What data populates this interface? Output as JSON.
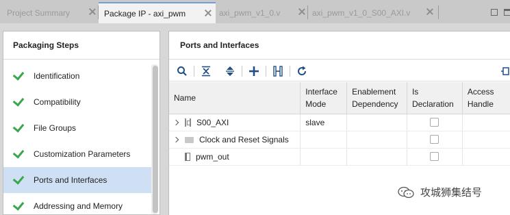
{
  "tabs": [
    {
      "label": "Project Summary",
      "active": false
    },
    {
      "label": "Package IP - axi_pwm",
      "active": true
    },
    {
      "label": "axi_pwm_v1_0.v",
      "active": false
    },
    {
      "label": "axi_pwm_v1_0_S00_AXI.v",
      "active": false
    }
  ],
  "left_panel": {
    "title": "Packaging Steps",
    "steps": [
      {
        "label": "Identification",
        "completed": true,
        "selected": false
      },
      {
        "label": "Compatibility",
        "completed": true,
        "selected": false
      },
      {
        "label": "File Groups",
        "completed": true,
        "selected": false
      },
      {
        "label": "Customization Parameters",
        "completed": true,
        "selected": false
      },
      {
        "label": "Ports and Interfaces",
        "completed": true,
        "selected": true
      },
      {
        "label": "Addressing and Memory",
        "completed": true,
        "selected": false
      }
    ]
  },
  "right_panel": {
    "title": "Ports and Interfaces",
    "toolbar_icons": [
      "search-icon",
      "collapse-all-icon",
      "expand-all-icon",
      "add-icon",
      "interface-icon",
      "refresh-icon"
    ],
    "columns": {
      "name": "Name",
      "interface_mode_1": "Interface",
      "interface_mode_2": "Mode",
      "enablement_1": "Enablement",
      "enablement_2": "Dependency",
      "is_declaration_1": "Is",
      "is_declaration_2": "Declaration",
      "access_handle_1": "Access",
      "access_handle_2": "Handle"
    },
    "rows": [
      {
        "name": "S00_AXI",
        "expandable": true,
        "icon": "bus-interface-icon",
        "interface_mode": "slave",
        "is_declaration": false
      },
      {
        "name": "Clock and Reset Signals",
        "expandable": true,
        "icon": "folder-icon",
        "interface_mode": "",
        "is_declaration": false
      },
      {
        "name": "pwm_out",
        "expandable": false,
        "icon": "port-icon",
        "interface_mode": "",
        "is_declaration": false
      }
    ]
  },
  "watermark": {
    "text": "攻城狮集结号",
    "icon": "wechat-icon"
  },
  "colors": {
    "check": "#3aa64d",
    "selected_row": "#cfe0f4",
    "toolbar_icon": "#1f4e86",
    "active_tab_accent": "#6f9fd8"
  }
}
